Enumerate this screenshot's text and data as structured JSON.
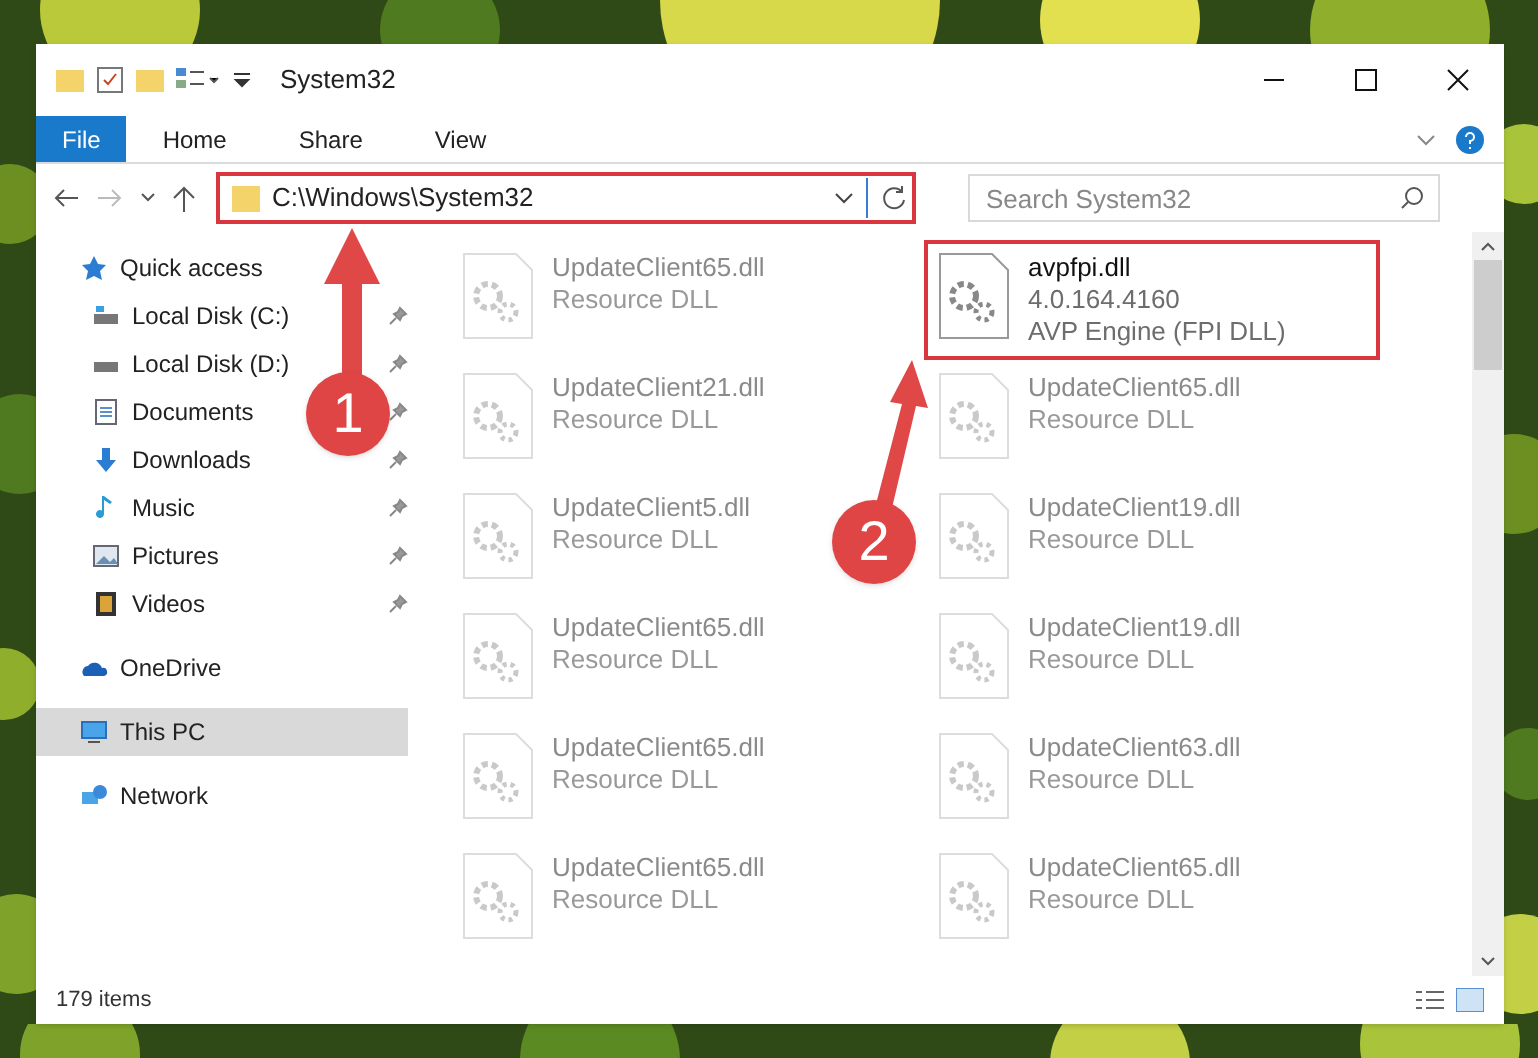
{
  "window": {
    "title": "System32"
  },
  "ribbon_tabs": [
    {
      "label": "File",
      "selected": true
    },
    {
      "label": "Home",
      "selected": false
    },
    {
      "label": "Share",
      "selected": false
    },
    {
      "label": "View",
      "selected": false
    }
  ],
  "address": {
    "path": "C:\\Windows\\System32",
    "highlighted": true
  },
  "search": {
    "placeholder": "Search System32"
  },
  "nav": [
    {
      "label": "Quick access",
      "selected": false,
      "children": [
        {
          "label": "Local Disk (C:)",
          "selected": false
        },
        {
          "label": "Local Disk (D:)",
          "selected": false
        },
        {
          "label": "Documents",
          "selected": false
        },
        {
          "label": "Downloads",
          "selected": false
        },
        {
          "label": "Music",
          "selected": false
        },
        {
          "label": "Pictures",
          "selected": false
        },
        {
          "label": "Videos",
          "selected": false
        }
      ]
    },
    {
      "label": "OneDrive",
      "selected": false
    },
    {
      "label": "This PC",
      "selected": true
    },
    {
      "label": "Network",
      "selected": false
    }
  ],
  "files": [
    {
      "name": "UpdateClient65.dll",
      "lines": [
        "Resource DLL"
      ],
      "blurred": true,
      "highlighted": false
    },
    {
      "name": "avpfpi.dll",
      "lines": [
        "4.0.164.4160",
        "AVP Engine (FPI DLL)"
      ],
      "blurred": false,
      "highlighted": true
    },
    {
      "name": "UpdateClient21.dll",
      "lines": [
        "Resource DLL"
      ],
      "blurred": true,
      "highlighted": false
    },
    {
      "name": "UpdateClient65.dll",
      "lines": [
        "Resource DLL"
      ],
      "blurred": true,
      "highlighted": false
    },
    {
      "name": "UpdateClient5.dll",
      "lines": [
        "Resource DLL"
      ],
      "blurred": true,
      "highlighted": false
    },
    {
      "name": "UpdateClient19.dll",
      "lines": [
        "Resource DLL"
      ],
      "blurred": true,
      "highlighted": false
    },
    {
      "name": "UpdateClient65.dll",
      "lines": [
        "Resource DLL"
      ],
      "blurred": true,
      "highlighted": false
    },
    {
      "name": "UpdateClient19.dll",
      "lines": [
        "Resource DLL"
      ],
      "blurred": true,
      "highlighted": false
    },
    {
      "name": "UpdateClient65.dll",
      "lines": [
        "Resource DLL"
      ],
      "blurred": true,
      "highlighted": false
    },
    {
      "name": "UpdateClient63.dll",
      "lines": [
        "Resource DLL"
      ],
      "blurred": true,
      "highlighted": false
    },
    {
      "name": "UpdateClient65.dll",
      "lines": [
        "Resource DLL"
      ],
      "blurred": true,
      "highlighted": false
    },
    {
      "name": "UpdateClient65.dll",
      "lines": [
        "Resource DLL"
      ],
      "blurred": true,
      "highlighted": false
    }
  ],
  "callouts": [
    {
      "number": "1"
    },
    {
      "number": "2"
    }
  ],
  "status_bar": {
    "count": "179 items"
  }
}
